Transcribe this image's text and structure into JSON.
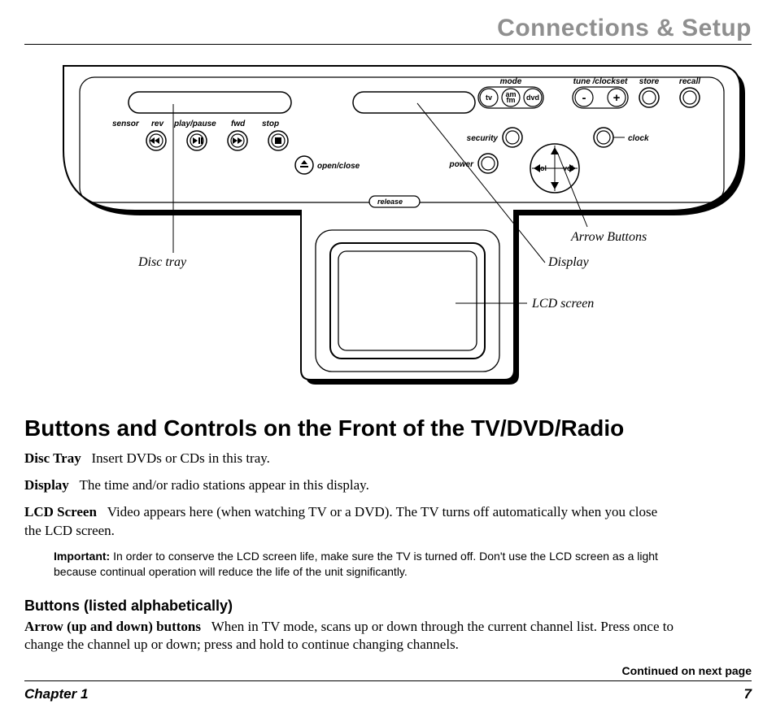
{
  "header": {
    "title": "Connections & Setup"
  },
  "diagram": {
    "labels": {
      "sensor": "sensor",
      "rev": "rev",
      "playpause": "play/pause",
      "fwd": "fwd",
      "stop": "stop",
      "openclose": "open/close",
      "release": "release",
      "mode": "mode",
      "tv": "tv",
      "amfm_top": "am",
      "amfm_bot": "fm",
      "dvd": "dvd",
      "security": "security",
      "power": "power",
      "clock": "clock",
      "tuneclockset": "tune /clockset",
      "store": "store",
      "recall": "recall",
      "minus": "-",
      "plus": "+",
      "vol_l": "vol",
      "vol_r": "vol"
    },
    "callouts": {
      "disc_tray": "Disc tray",
      "arrow_buttons": "Arrow Buttons",
      "display": "Display",
      "lcd_screen": "LCD screen"
    }
  },
  "section_heading": "Buttons and Controls on the Front of the TV/DVD/Radio",
  "defs": {
    "disc_tray": {
      "term": "Disc Tray",
      "text": "Insert DVDs or CDs in this tray."
    },
    "display": {
      "term": "Display",
      "text": "The time and/or radio stations appear in this display."
    },
    "lcd": {
      "term": "LCD Screen",
      "text": "Video appears here (when watching TV or a DVD). The TV turns off automatically when you close the LCD screen."
    }
  },
  "important": {
    "label": "Important:",
    "text": "In order to conserve the LCD screen life, make sure the TV is turned off. Don't use the LCD screen as a light because continual operation will reduce the life of the unit significantly."
  },
  "sub_heading": "Buttons (listed alphabetically)",
  "arrow_def": {
    "term": "Arrow (up and down) buttons",
    "text": "When in TV mode, scans up or down through the current channel list. Press once to change the channel up or down; press and hold to continue changing channels."
  },
  "continued": "Continued on next page",
  "footer": {
    "chapter": "Chapter 1",
    "page": "7"
  }
}
